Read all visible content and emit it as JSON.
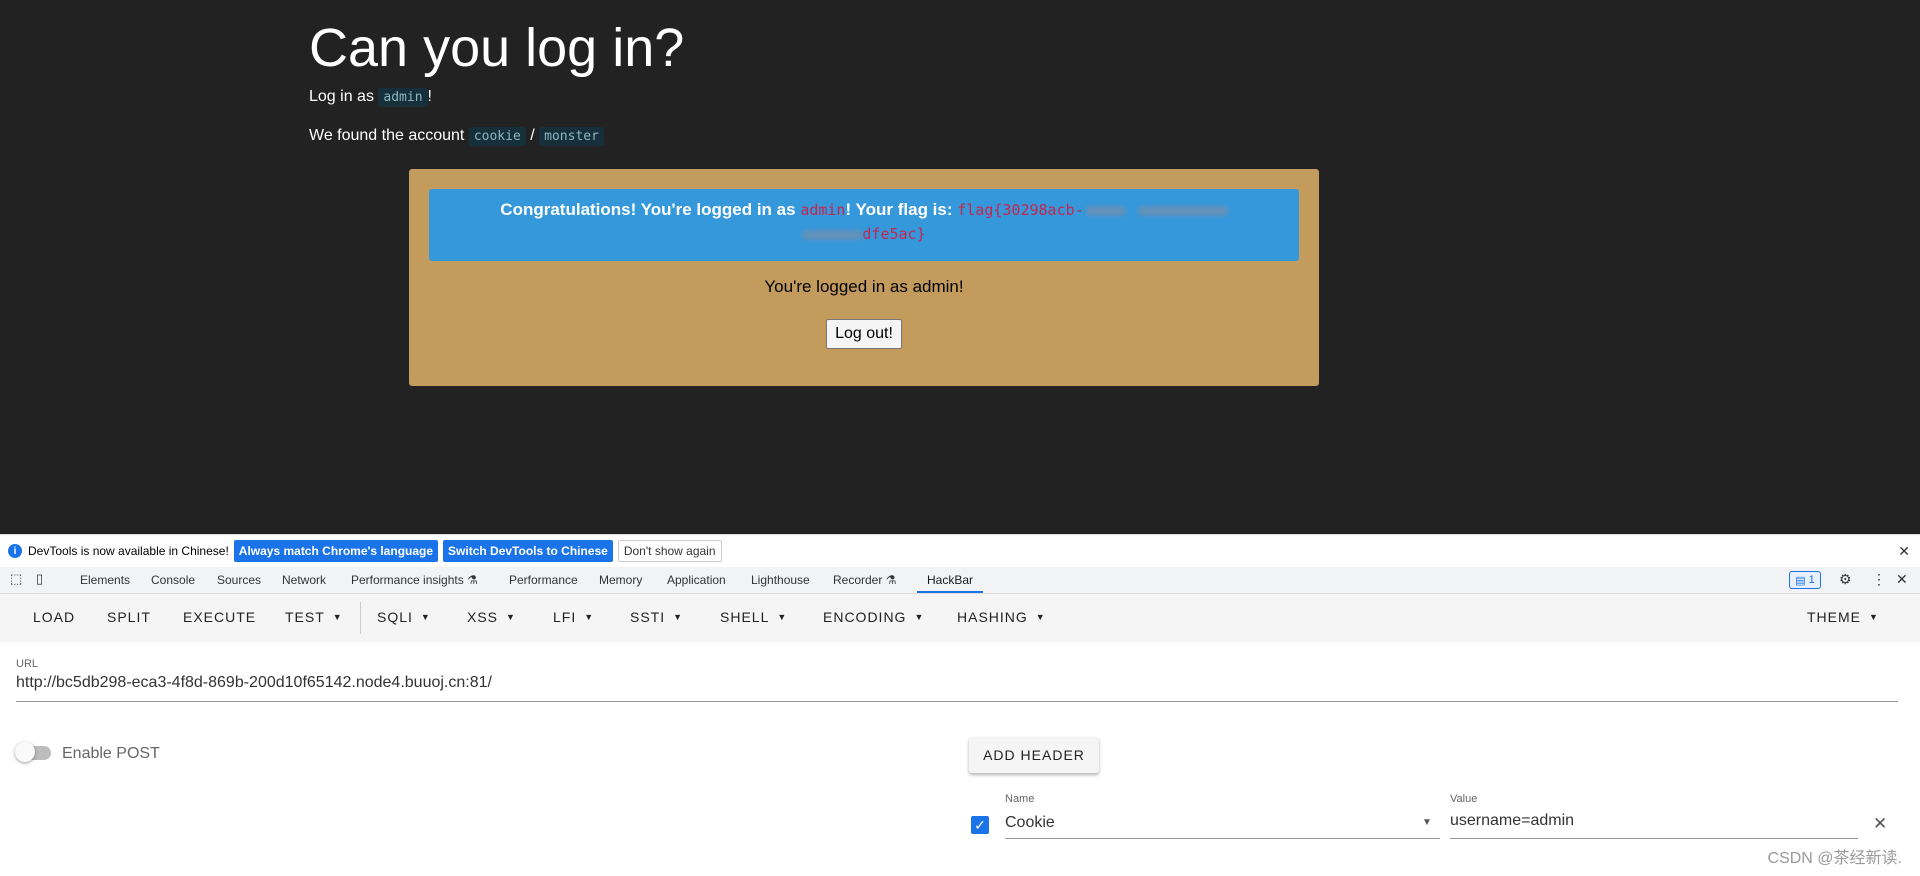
{
  "page": {
    "title": "Can you log in?",
    "login_prefix": "Log in as",
    "login_user": "admin",
    "login_suffix": "!",
    "found_prefix": "We found the account",
    "found_user": "cookie",
    "found_sep": "/",
    "found_pass": "monster",
    "alert_prefix": "Congratulations! You're logged in as",
    "alert_user": "admin",
    "alert_mid": "! Your flag is:",
    "flag_start": "flag{30298acb-",
    "flag_end": "dfe5ac}",
    "logged_in_text": "You're logged in as admin!",
    "logout_label": "Log out!"
  },
  "devtools": {
    "info_text": "DevTools is now available in Chinese!",
    "btn_match": "Always match Chrome's language",
    "btn_switch": "Switch DevTools to Chinese",
    "btn_dont": "Don't show again",
    "tabs": [
      "Elements",
      "Console",
      "Sources",
      "Network",
      "Performance insights",
      "Performance",
      "Memory",
      "Application",
      "Lighthouse",
      "Recorder",
      "HackBar"
    ],
    "issues_count": "1"
  },
  "hackbar": {
    "toolbar": [
      "LOAD",
      "SPLIT",
      "EXECUTE",
      "TEST",
      "SQLI",
      "XSS",
      "LFI",
      "SSTI",
      "SHELL",
      "ENCODING",
      "HASHING",
      "THEME"
    ],
    "url_label": "URL",
    "url_value": "http://bc5db298-eca3-4f8d-869b-200d10f65142.node4.buuoj.cn:81/",
    "enable_post": "Enable POST",
    "add_header": "ADD HEADER",
    "header_name_label": "Name",
    "header_name": "Cookie",
    "header_value_label": "Value",
    "header_value": "username=admin"
  },
  "watermark": "CSDN @茶经新读."
}
